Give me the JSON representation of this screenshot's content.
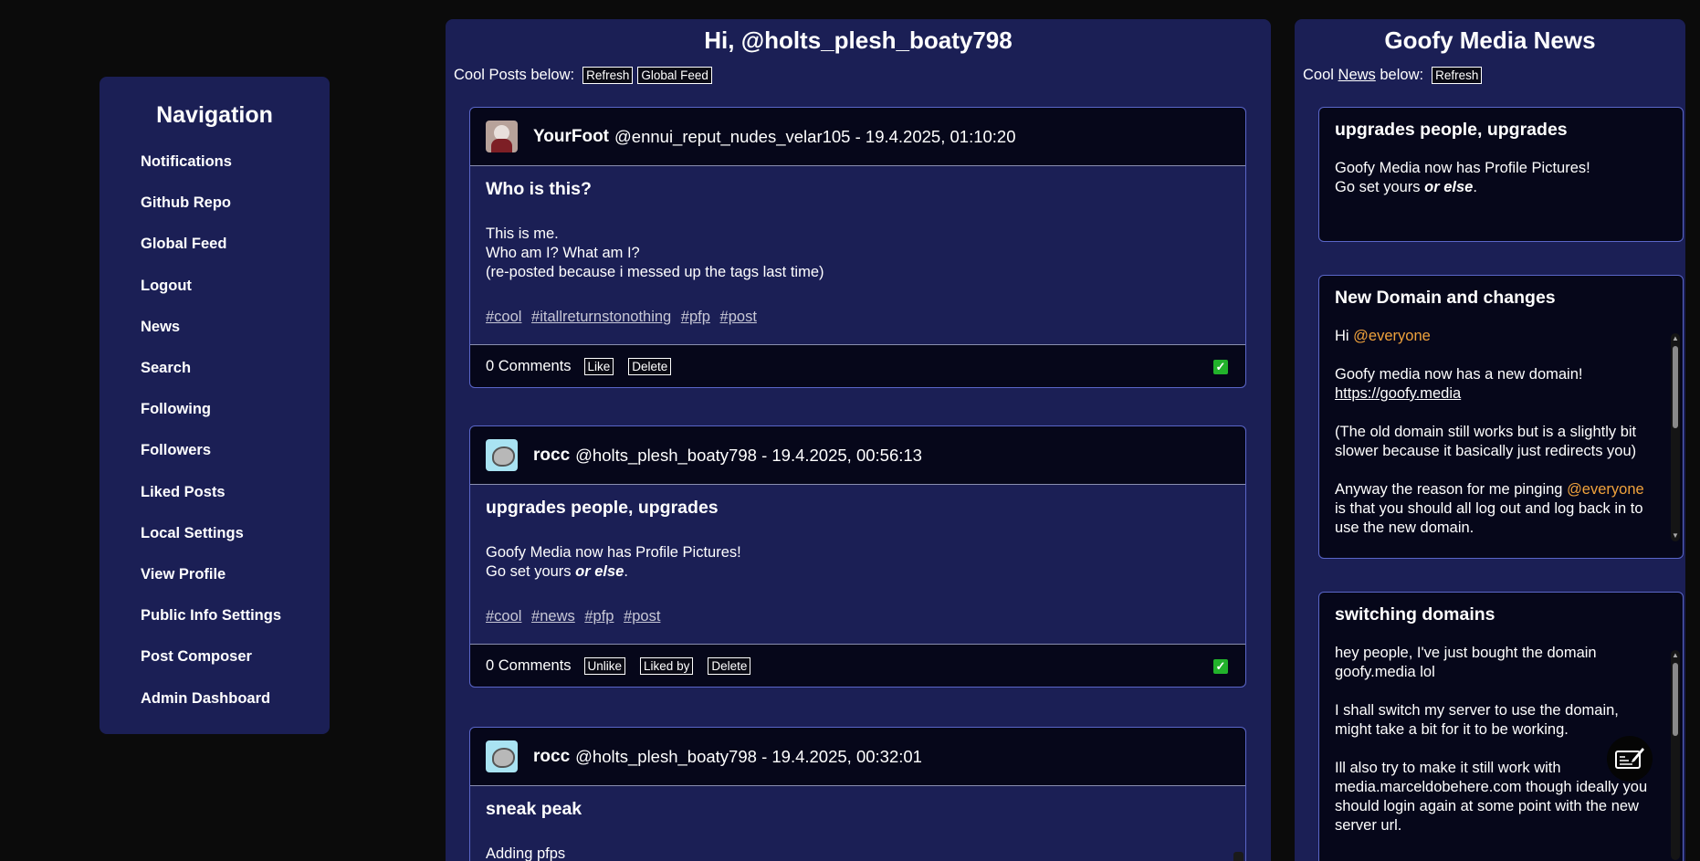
{
  "nav": {
    "title": "Navigation",
    "items": [
      "Notifications",
      "Github Repo",
      "Global Feed",
      "Logout",
      "News",
      "Search",
      "Following",
      "Followers",
      "Liked Posts",
      "Local Settings",
      "View Profile",
      "Public Info Settings",
      "Post Composer",
      "Admin Dashboard"
    ]
  },
  "main": {
    "greeting": "Hi, @holts_plesh_boaty798",
    "subtitle": "Cool Posts below:",
    "refresh": "Refresh",
    "global_feed": "Global Feed"
  },
  "posts": [
    {
      "display_name": "YourFoot",
      "meta": "@ennui_reput_nudes_velar105 - 19.4.2025, 01:10:20",
      "title": "Who is this?",
      "lines": [
        "This is me.",
        "Who am I? What am I?",
        "(re-posted because i messed up the tags last time)"
      ],
      "tags": [
        "#cool",
        "#itallreturnstonothing",
        "#pfp",
        "#post"
      ],
      "comments": "0 Comments",
      "buttons": [
        "Like",
        "Delete"
      ],
      "check": "✓"
    },
    {
      "display_name": "rocc",
      "meta": "@holts_plesh_boaty798 - 19.4.2025, 00:56:13",
      "title": "upgrades people, upgrades",
      "line1": "Goofy Media now has Profile Pictures!",
      "line2_prefix": "Go set yours ",
      "line2_em": "or else",
      "line2_suffix": ".",
      "tags": [
        "#cool",
        "#news",
        "#pfp",
        "#post"
      ],
      "comments": "0 Comments",
      "buttons": [
        "Unlike",
        "Liked by",
        "Delete"
      ],
      "check": "✓"
    },
    {
      "display_name": "rocc",
      "meta": "@holts_plesh_boaty798 - 19.4.2025, 00:32:01",
      "title": "sneak peak",
      "lines": [
        "Adding pfps"
      ]
    }
  ],
  "news": {
    "title": "Goofy Media News",
    "subtitle_prefix": "Cool ",
    "subtitle_link": "News",
    "subtitle_suffix": " below:",
    "refresh": "Refresh",
    "cards": [
      {
        "title": "upgrades people, upgrades",
        "line1": "Goofy Media now has Profile Pictures!",
        "line2_prefix": "Go set yours ",
        "line2_em": "or else",
        "line2_suffix": "."
      },
      {
        "title": "New Domain and changes",
        "hi": "Hi ",
        "mention": "@everyone",
        "p1": "Goofy media now has a new domain!",
        "link": "https://goofy.media",
        "p2": "(The old domain still works but is a slightly bit slower because it basically just redirects you)",
        "p3_prefix": "Anyway the reason for me pinging ",
        "p3_mention": "@everyone",
        "p3_suffix": " is that you should all log out and log back in to use the new domain."
      },
      {
        "title": "switching domains",
        "p1": "hey people, I've just bought the domain goofy.media lol",
        "p2": "I shall switch my server to use the domain, might take a bit for it to be working.",
        "p3": "Ill also try to make it still work with media.marceldobehere.com though ideally you should login again at some point with the new server url."
      }
    ]
  },
  "icons": {
    "fab": "compose-icon",
    "check": "checkbox-checked-icon"
  }
}
